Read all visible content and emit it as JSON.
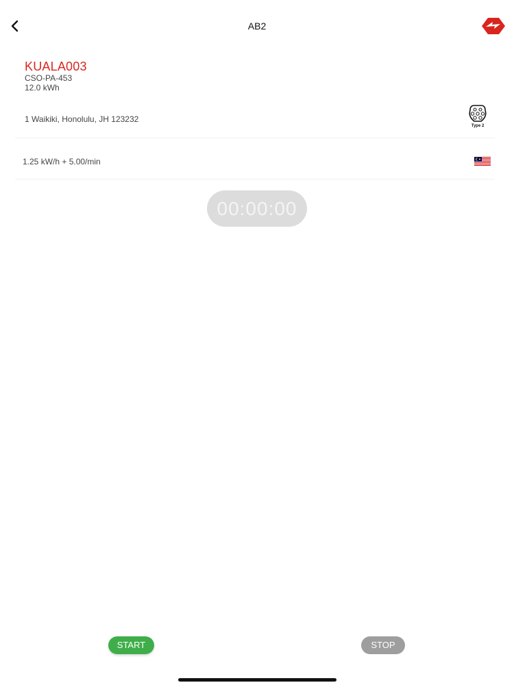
{
  "header": {
    "title": "AB2",
    "back_icon": "chevron-left-icon",
    "logo_icon": "brand-logo-icon",
    "accent_color": "#d8261f"
  },
  "station": {
    "name": "KUALA003",
    "code": "CSO-PA-453",
    "power": "12.0 kWh"
  },
  "address": {
    "text": "1 Waikiki, Honolulu, JH 123232",
    "connector_icon": "type2-connector-icon",
    "connector_label": "Type 2"
  },
  "rate": {
    "text": "1.25 kW/h + 5.00/min",
    "flag_icon": "malaysia-flag-icon"
  },
  "timer": {
    "value": "00:00:00"
  },
  "actions": {
    "start_label": "START",
    "start_color": "#3fae4a",
    "stop_label": "STOP",
    "stop_color": "#9e9e9e"
  }
}
